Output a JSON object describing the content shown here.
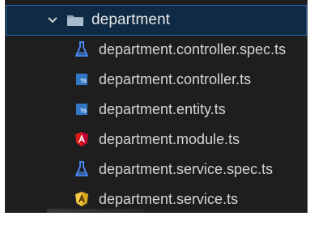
{
  "folder": {
    "name": "department",
    "expanded": true,
    "accent_color": "#2b6cb0",
    "folder_color": "#90a4ae"
  },
  "files": [
    {
      "name": "department.controller.spec.ts",
      "icon": "flask-icon",
      "icon_color": "#4b8cff"
    },
    {
      "name": "department.controller.ts",
      "icon": "typescript-icon",
      "icon_color": "#3178c6"
    },
    {
      "name": "department.entity.ts",
      "icon": "typescript-icon",
      "icon_color": "#3178c6"
    },
    {
      "name": "department.module.ts",
      "icon": "angular-icon",
      "icon_color": "#dd1b16"
    },
    {
      "name": "department.service.spec.ts",
      "icon": "flask-icon",
      "icon_color": "#4b8cff"
    },
    {
      "name": "department.service.ts",
      "icon": "angular-service-icon",
      "icon_color": "#f2c744"
    }
  ],
  "ts_badge_text": "TS"
}
